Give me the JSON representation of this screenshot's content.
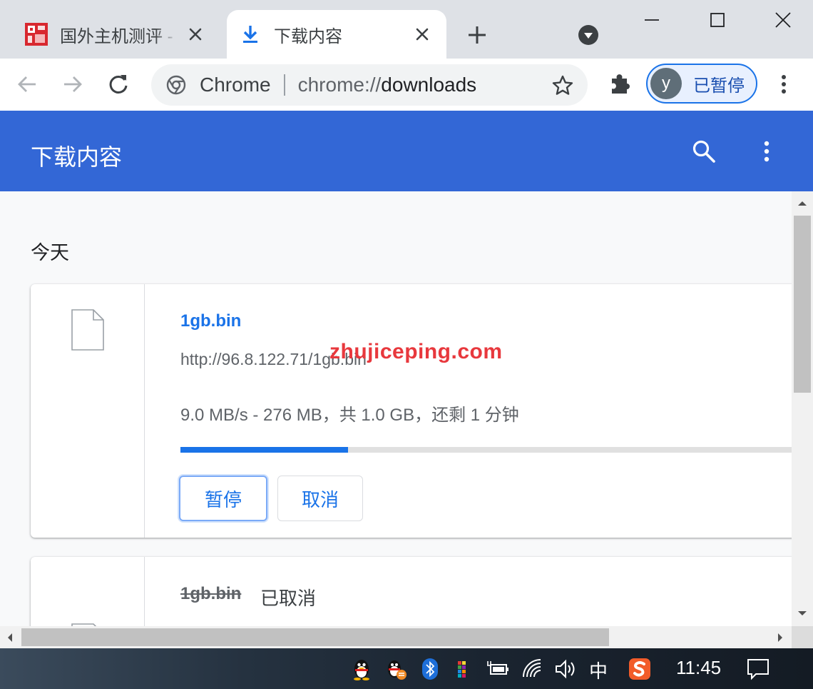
{
  "tabs": [
    {
      "title": "国外主机测评 - 国外VPS",
      "active": false,
      "favicon": "zhujiceping-favicon"
    },
    {
      "title": "下载内容",
      "active": true,
      "favicon": "download-icon"
    }
  ],
  "toolbar": {
    "omnibox_chip": "Chrome",
    "url_scheme": "chrome://",
    "url_path": "downloads",
    "profile_initial": "y",
    "profile_label": "已暂停"
  },
  "header": {
    "title": "下载内容"
  },
  "downloads": {
    "section_label": "今天",
    "items": [
      {
        "file_name": "1gb.bin",
        "url": "http://96.8.122.71/1gb.bin",
        "status": "9.0 MB/s - 276 MB，共 1.0 GB，还剩 1 分钟",
        "progress_fraction": 0.27,
        "pause_label": "暂停",
        "cancel_label": "取消"
      },
      {
        "file_name": "1gb.bin",
        "state": "已取消"
      }
    ]
  },
  "watermark": "zhujiceping.com",
  "taskbar": {
    "ime_label": "中",
    "clock": "11:45"
  },
  "colors": {
    "header_blue": "#3367d6",
    "link_blue": "#1a73e8",
    "watermark_red": "#e8383d"
  }
}
